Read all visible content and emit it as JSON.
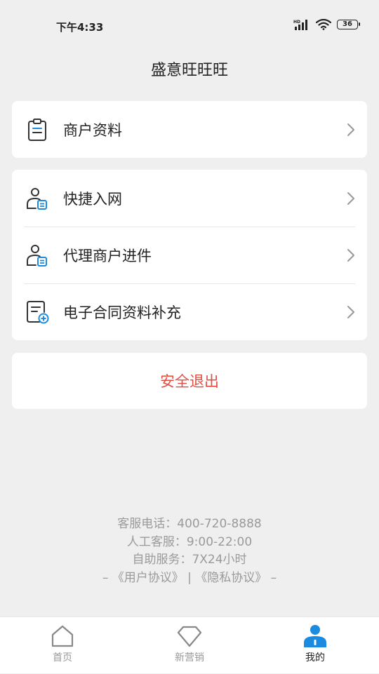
{
  "status_bar": {
    "time": "下午4:33",
    "signal_label": "HD",
    "battery": "36"
  },
  "header": {
    "title": "盛意旺旺旺"
  },
  "menu_group_1": [
    {
      "label": "商户资料",
      "icon": "clipboard-icon"
    }
  ],
  "menu_group_2": [
    {
      "label": "快捷入网",
      "icon": "user-card-icon"
    },
    {
      "label": "代理商户进件",
      "icon": "user-card-icon"
    },
    {
      "label": "电子合同资料补充",
      "icon": "document-add-icon"
    }
  ],
  "logout_label": "安全退出",
  "footer": {
    "hotline": "客服电话：400-720-8888",
    "manual_service": "人工客服：9:00-22:00",
    "self_service": "自助服务：7X24小时",
    "agreements": "– 《用户协议》 | 《隐私协议》 –"
  },
  "tabbar": {
    "tabs": [
      {
        "label": "首页",
        "icon": "home-icon",
        "active": false
      },
      {
        "label": "新营销",
        "icon": "diamond-icon",
        "active": false
      },
      {
        "label": "我的",
        "icon": "profile-icon",
        "active": true
      }
    ]
  },
  "colors": {
    "accent": "#1a8be0",
    "logout": "#e34d42",
    "background": "#efefef"
  }
}
